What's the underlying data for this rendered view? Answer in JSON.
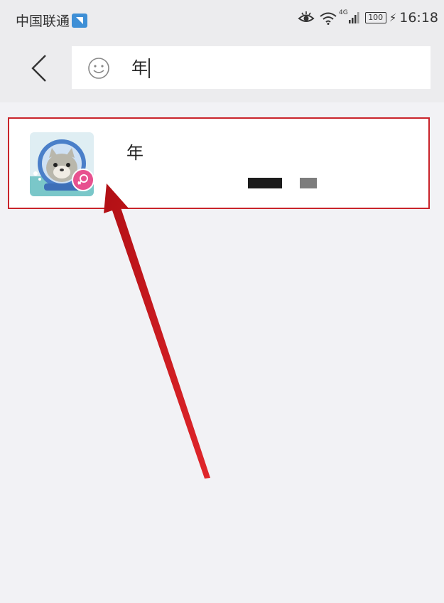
{
  "status_bar": {
    "carrier": "中国联通",
    "network": "4G",
    "battery": "100",
    "time": "16:18"
  },
  "search": {
    "query": "年"
  },
  "results": [
    {
      "name": "年"
    }
  ],
  "colors": {
    "highlight_border": "#c9242b",
    "arrow": "#d11a1a",
    "badge": "#e7518f"
  }
}
